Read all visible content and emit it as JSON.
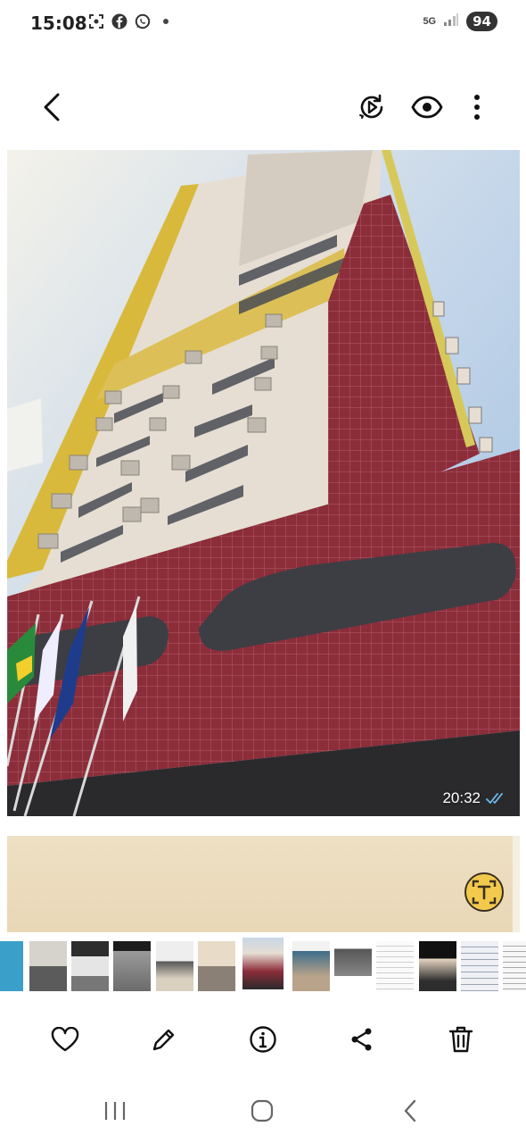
{
  "status_bar": {
    "time": "15:08",
    "notification_icons": [
      "screenshot-icon",
      "facebook-icon",
      "whatsapp-icon",
      "dot-icon"
    ],
    "network_label": "5G",
    "battery": "94"
  },
  "toolbar": {
    "icons": [
      "back-icon",
      "remaster-icon",
      "visibility-icon",
      "more-icon"
    ]
  },
  "photo": {
    "timestamp": "20:32",
    "read_status": "double-check-icon"
  },
  "filmstrip": {
    "thumbnail_count": 13,
    "active_index": 6
  },
  "actions": {
    "icons": [
      "favorite-icon",
      "edit-icon",
      "info-icon",
      "share-icon",
      "delete-icon"
    ]
  },
  "navbar": {
    "icons": [
      "recent-apps-icon",
      "home-icon",
      "back-nav-icon"
    ]
  },
  "colors": {
    "tile_red": "#8c2d3a",
    "facade_cream": "#e6ded3",
    "accent_yellow": "#d9b93c",
    "sky": "#c9d9ea",
    "scan_button": "#f2c94c"
  }
}
